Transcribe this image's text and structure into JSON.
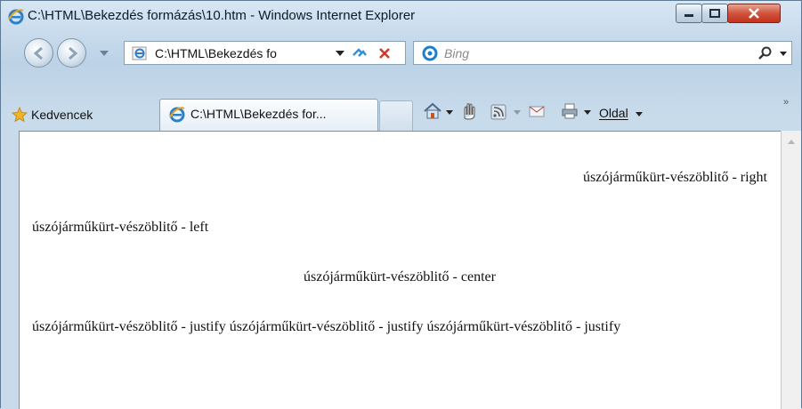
{
  "window": {
    "title": "C:\\HTML\\Bekezdés formázás\\10.htm - Windows Internet Explorer",
    "minimize_icon": "minimize-icon",
    "maximize_icon": "maximize-icon",
    "close_icon": "close-icon"
  },
  "navigation": {
    "address": "C:\\HTML\\Bekezdés fo",
    "search_placeholder": "Bing"
  },
  "favorites": {
    "label": "Kedvencek"
  },
  "tab": {
    "label": "C:\\HTML\\Bekezdés for..."
  },
  "command_bar": {
    "page_label": "Oldal"
  },
  "content": {
    "right": "úszójárműkürt-vészöblitő - right",
    "left": "úszójárműkürt-vészöblitő - left",
    "center": "úszójárműkürt-vészöblitő - center",
    "justify": "úszójárműkürt-vészöblitő - justify úszójárműkürt-vészöblitő - justify úszójárműkürt-vészöblitő - justify"
  },
  "colors": {
    "chrome": "#c9dbea",
    "close_button": "#c4321c",
    "ie_logo": "#2f7fc8",
    "bing_blue": "#1b7fcf"
  }
}
